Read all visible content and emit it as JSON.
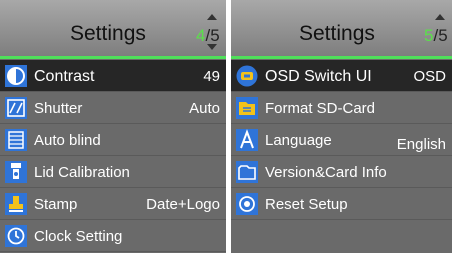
{
  "left_panel": {
    "title": "Settings",
    "page_current": "4",
    "page_separator": "/",
    "page_total": "5",
    "items": [
      {
        "label": "Contrast",
        "value": "49"
      },
      {
        "label": "Shutter",
        "value": "Auto"
      },
      {
        "label": "Auto blind",
        "value": ""
      },
      {
        "label": "Lid Calibration",
        "value": ""
      },
      {
        "label": "Stamp",
        "value": "Date+Logo"
      },
      {
        "label": "Clock Setting",
        "value": ""
      }
    ]
  },
  "right_panel": {
    "title": "Settings",
    "page_current": "5",
    "page_separator": "/",
    "page_total": "5",
    "items": [
      {
        "label": "OSD Switch UI",
        "value": "OSD"
      },
      {
        "label": "Format SD-Card",
        "value": ""
      },
      {
        "label": "Language",
        "value": "English"
      },
      {
        "label": "Version&Card Info",
        "value": ""
      },
      {
        "label": "Reset Setup",
        "value": ""
      }
    ]
  },
  "colors": {
    "accent_green": "#4fe05a",
    "selected_row": "#262626",
    "panel_bg": "#6a6a6a",
    "icon_blue": "#2f74d8",
    "icon_yellow": "#f2c21b"
  }
}
